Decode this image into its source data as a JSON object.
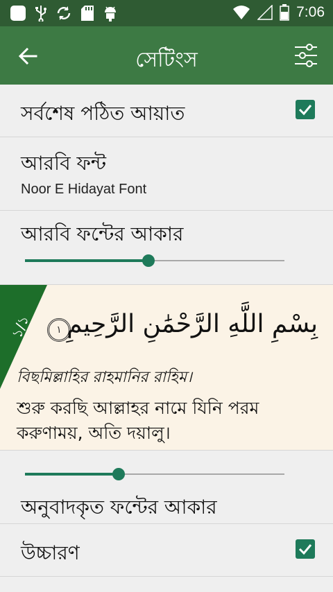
{
  "status_bar": {
    "time": "7:06",
    "icons": [
      "app-icon",
      "usb-icon",
      "sync-icon",
      "sd-card-icon",
      "android-icon",
      "wifi-icon",
      "signal-icon",
      "battery-icon"
    ]
  },
  "app_bar": {
    "title": "সেটিংস",
    "back_icon": "back-arrow-icon",
    "filter_icon": "filter-icon"
  },
  "settings": {
    "last_read": {
      "label": "সর্বশেষ পঠিত আয়াত",
      "checked": true
    },
    "arabic_font": {
      "label": "আরবি ফন্ট",
      "value": "Noor E Hidayat Font"
    },
    "arabic_font_size": {
      "label": "আরবি ফন্টের আকার",
      "level": 0.475
    },
    "translation_font_size": {
      "label": "অনুবাদকৃত ফন্টের আকার",
      "level": 0.36
    },
    "pronunciation": {
      "label": "উচ্চারণ",
      "checked": true
    }
  },
  "preview": {
    "corner_label": "১/১",
    "arabic": "بِسْمِ اللَّهِ الرَّحْمَٰنِ الرَّحِيمِ",
    "ayah_number": "١",
    "transliteration": "বিছমিল্লাহির রাহমানির রাহিম।",
    "translation": "শুরু করছি আল্লাহর নামে যিনি পরম করুণাময়, অতি দয়ালু।"
  },
  "colors": {
    "status_bar": "#2f5b33",
    "app_bar": "#3d7a44",
    "accent": "#1e7a5a",
    "preview_bg": "#fbf3e6",
    "corner": "#1d6e2a"
  }
}
